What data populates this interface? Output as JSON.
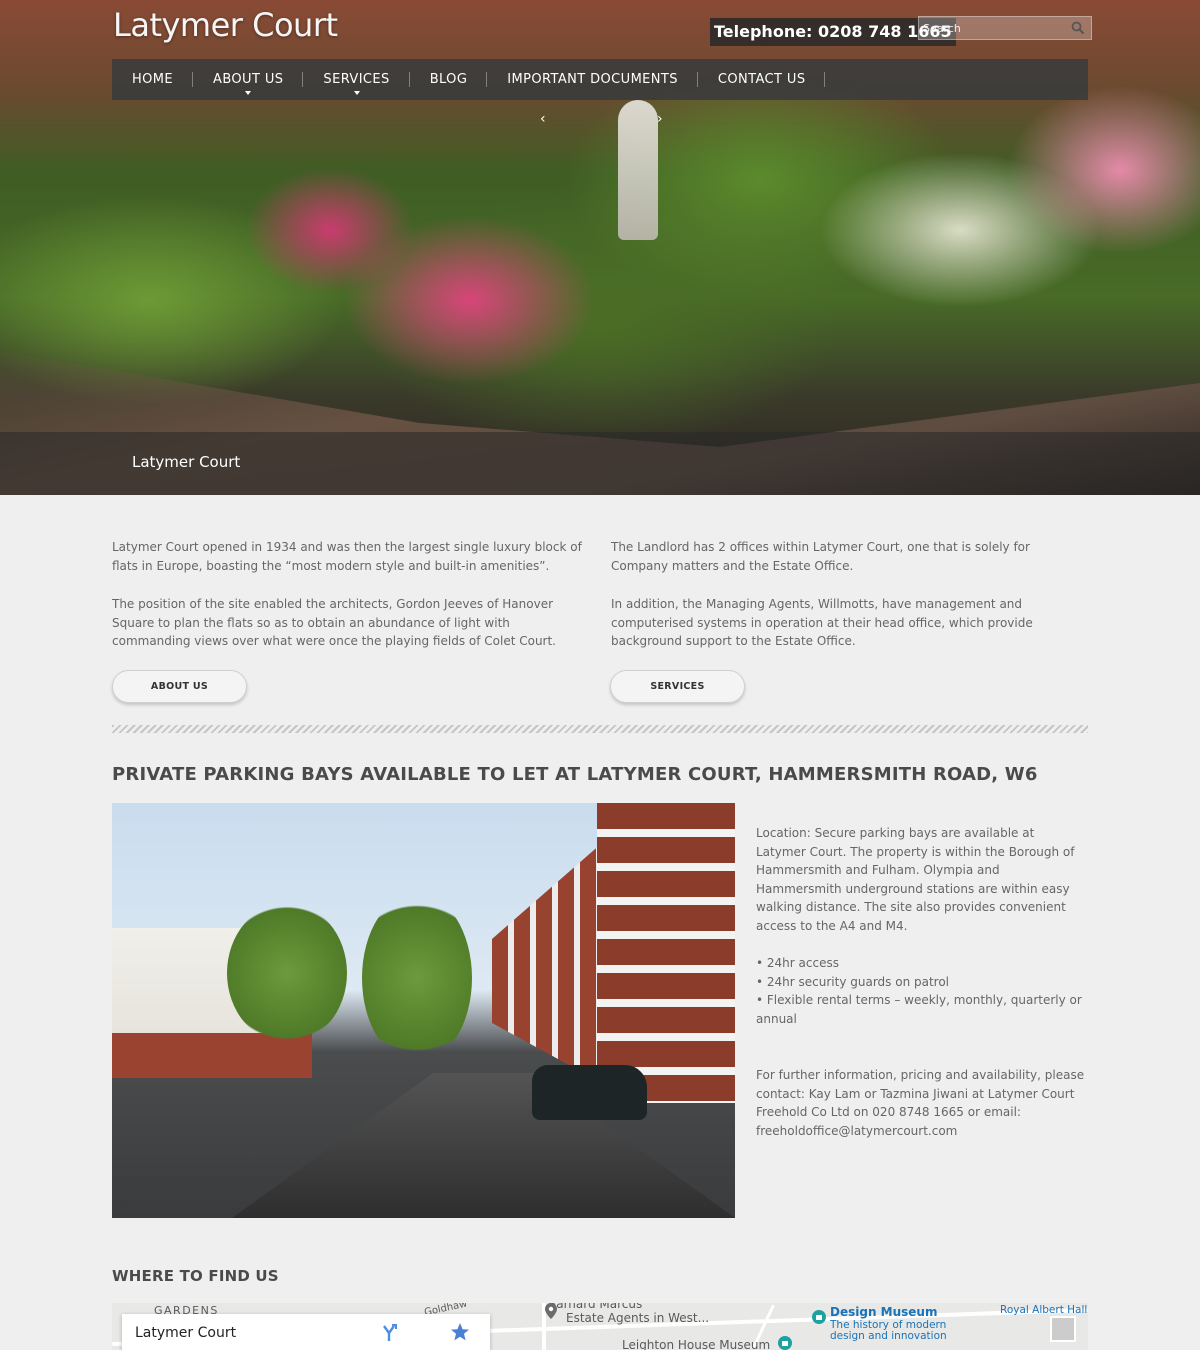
{
  "header": {
    "site_title": "Latymer Court",
    "telephone": "Telephone: 0208 748 1665",
    "search_placeholder": "Search"
  },
  "nav": {
    "items": [
      {
        "label": "HOME",
        "has_dropdown": false
      },
      {
        "label": "ABOUT US",
        "has_dropdown": true
      },
      {
        "label": "SERVICES",
        "has_dropdown": true
      },
      {
        "label": "BLOG",
        "has_dropdown": false
      },
      {
        "label": "IMPORTANT DOCUMENTS",
        "has_dropdown": false
      },
      {
        "label": "CONTACT US",
        "has_dropdown": false
      }
    ]
  },
  "slider": {
    "prev_icon": "‹",
    "next_icon": "›",
    "caption": "Latymer Court"
  },
  "intro": {
    "left": [
      "Latymer Court opened in 1934 and was then the largest single luxury block of flats in Europe, boasting the “most modern style and built-in amenities”.",
      "The position of the site enabled the architects, Gordon Jeeves of Hanover Square to plan the flats so as to obtain an abundance of light with commanding views over what were once the playing fields of Colet Court."
    ],
    "right": [
      "The Landlord has 2 offices within Latymer Court, one that is solely for Company matters and the Estate Office.",
      "In addition, the Managing Agents, Willmotts, have management and computerised systems in operation at their head office, which provide background support to the Estate Office."
    ],
    "about_button": "ABOUT US",
    "services_button": "SERVICES"
  },
  "parking": {
    "title": "PRIVATE PARKING BAYS AVAILABLE TO LET AT LATYMER COURT, HAMMERSMITH ROAD, W6",
    "location": "Location: Secure parking bays are available at Latymer Court. The property is within the Borough of Hammersmith and Fulham. Olympia and Hammersmith underground stations are within easy walking distance. The site also provides convenient access to the A4 and M4.",
    "features": [
      "• 24hr access",
      "• 24hr security guards on patrol",
      "• Flexible rental terms – weekly, monthly, quarterly or annual"
    ],
    "contact": "For further information, pricing and availability, please contact: Kay Lam or Tazmina Jiwani at Latymer Court Freehold Co Ltd on 020 8748 1665 or email: freeholdoffice@latymercourt.com"
  },
  "find_us": {
    "title": "WHERE TO FIND US",
    "map_card_title": "Latymer Court",
    "labels": {
      "gardens": "GARDENS",
      "goldhawk": "Goldhaw",
      "barnard": "Barnard Marcus",
      "estate_agents": "Estate Agents in West...",
      "design_museum": "Design Museum",
      "design_sub1": "The history of modern",
      "design_sub2": "design and innovation",
      "royal_albert": "Royal Albert Hall",
      "leighton": "Leighton House Museum"
    }
  }
}
